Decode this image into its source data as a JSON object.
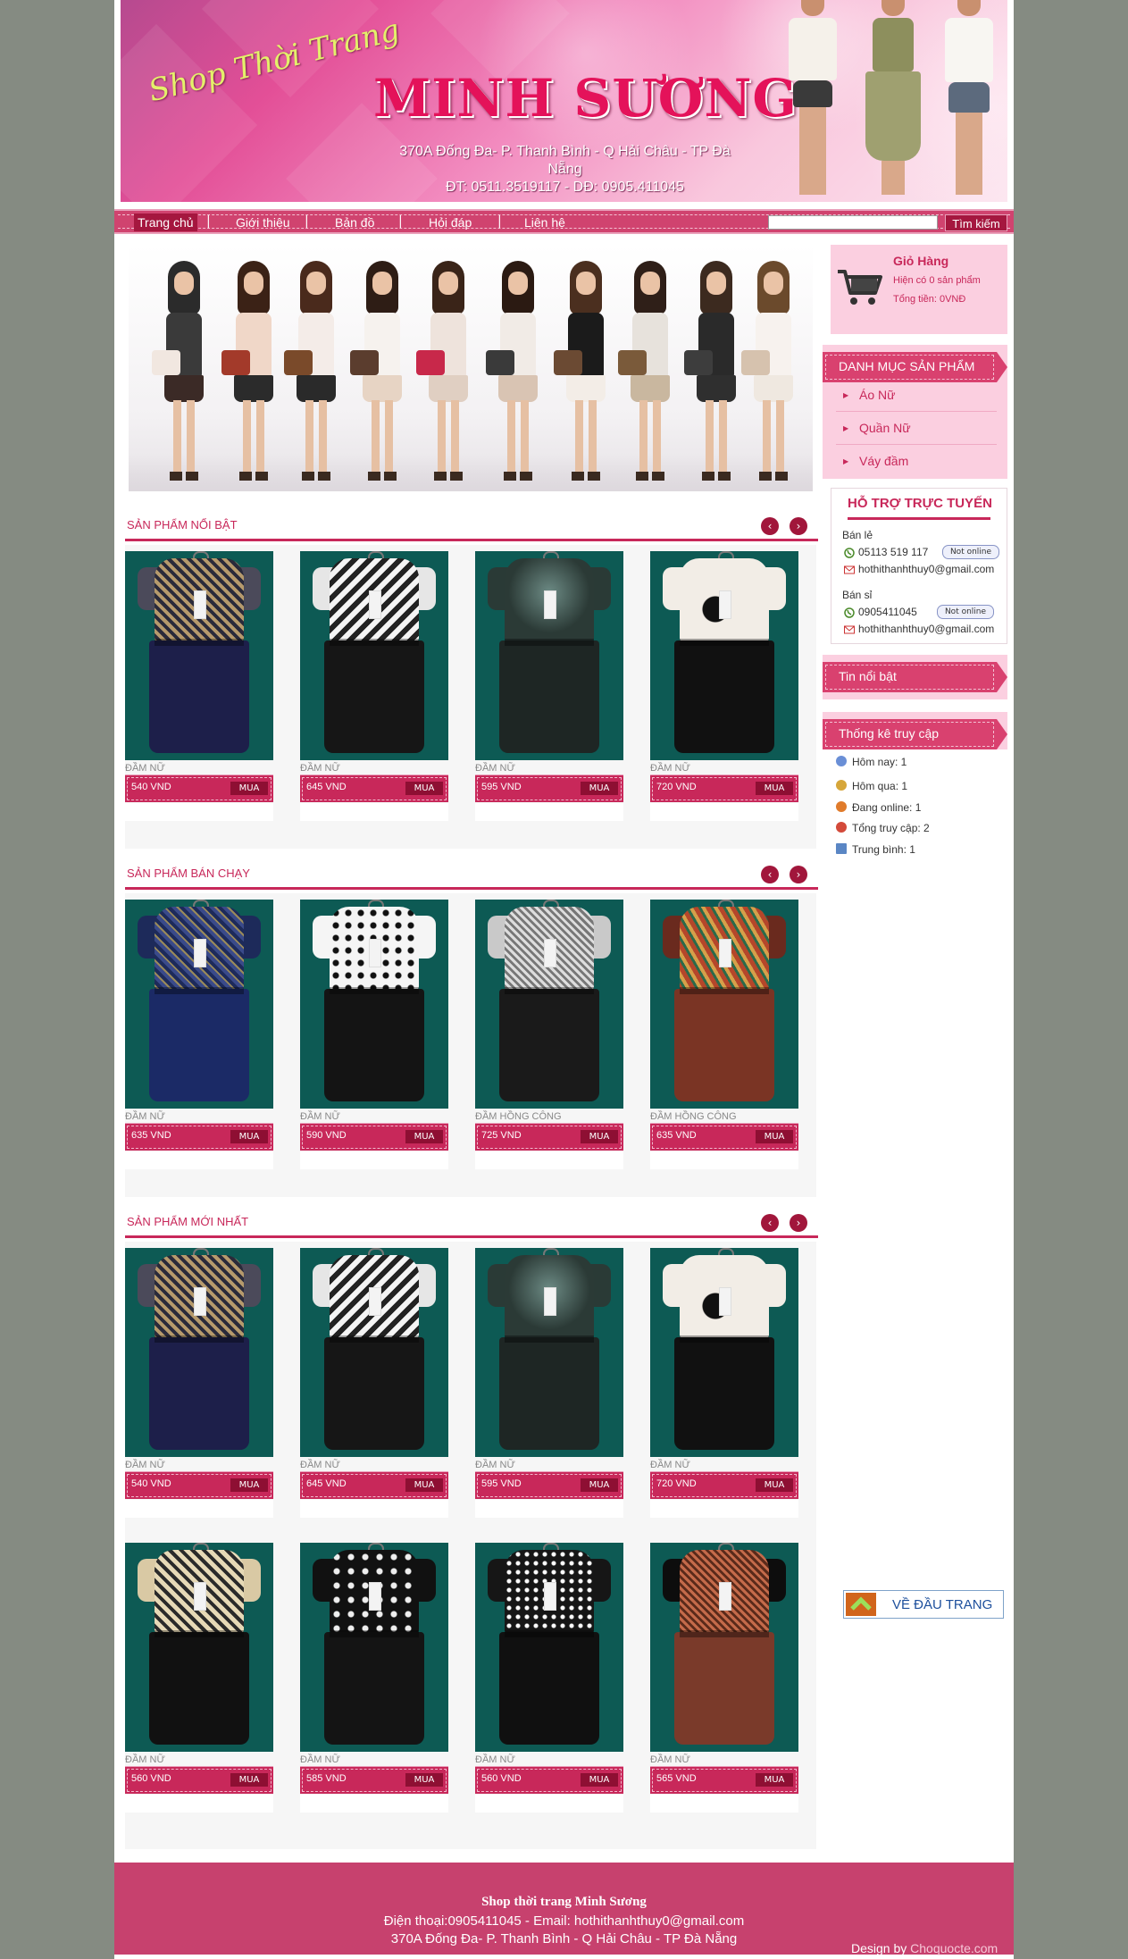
{
  "header": {
    "script_title": "Shop Thời Trang",
    "shop_name": "MINH SƯƠNG",
    "address": "370A Đống Đa- P. Thanh Bình - Q Hải Châu - TP Đà Nẵng",
    "phones": "ĐT: 0511.3519117 - DĐ: 0905.411045"
  },
  "nav": {
    "items": [
      {
        "label": "Trang chủ"
      },
      {
        "label": "Giới thiệu"
      },
      {
        "label": "Bản đồ"
      },
      {
        "label": "Hỏi đáp"
      },
      {
        "label": "Liên hệ"
      }
    ],
    "separator": "|",
    "search_placeholder": "",
    "search_button": "Tìm kiếm"
  },
  "arrows": {
    "prev": "‹",
    "next": "›"
  },
  "sections": [
    {
      "title": "SẢN PHẨM NỔI BẬT",
      "products": [
        {
          "category": "ĐẦM NỮ",
          "price": "540 VND",
          "buy": "MUA"
        },
        {
          "category": "ĐẦM NỮ",
          "price": "645 VND",
          "buy": "MUA"
        },
        {
          "category": "ĐẦM NỮ",
          "price": "595 VND",
          "buy": "MUA"
        },
        {
          "category": "ĐẦM NỮ",
          "price": "720 VND",
          "buy": "MUA"
        }
      ]
    },
    {
      "title": "SẢN PHẨM BÁN CHẠY",
      "products": [
        {
          "category": "ĐẦM NỮ",
          "price": "635 VND",
          "buy": "MUA"
        },
        {
          "category": "ĐẦM NỮ",
          "price": "590 VND",
          "buy": "MUA"
        },
        {
          "category": "ĐẦM HỒNG CÔNG",
          "price": "725 VND",
          "buy": "MUA"
        },
        {
          "category": "ĐẦM HỒNG CÔNG",
          "price": "635 VND",
          "buy": "MUA"
        }
      ]
    },
    {
      "title": "SẢN PHẨM MỚI NHẤT",
      "products": [
        {
          "category": "ĐẦM NỮ",
          "price": "540 VND",
          "buy": "MUA"
        },
        {
          "category": "ĐẦM NỮ",
          "price": "645 VND",
          "buy": "MUA"
        },
        {
          "category": "ĐẦM NỮ",
          "price": "595 VND",
          "buy": "MUA"
        },
        {
          "category": "ĐẦM NỮ",
          "price": "720 VND",
          "buy": "MUA"
        },
        {
          "category": "ĐẦM NỮ",
          "price": "560 VND",
          "buy": "MUA"
        },
        {
          "category": "ĐẦM NỮ",
          "price": "585 VND",
          "buy": "MUA"
        },
        {
          "category": "ĐẦM NỮ",
          "price": "560 VND",
          "buy": "MUA"
        },
        {
          "category": "ĐẦM NỮ",
          "price": "565 VND",
          "buy": "MUA"
        }
      ]
    }
  ],
  "cart": {
    "title": "Giỏ Hàng",
    "count_text": "Hiện có 0 sản phẩm",
    "total_text": "Tổng tiền: 0VNĐ"
  },
  "categories": {
    "title": "DANH MỤC SẢN PHẨM",
    "items": [
      {
        "label": "Áo Nữ"
      },
      {
        "label": "Quần Nữ"
      },
      {
        "label": "Váy đầm"
      }
    ]
  },
  "support": {
    "title": "HỖ TRỢ TRỰC TUYẾN",
    "retail_label": "Bán lẻ",
    "retail_phone": "05113 519 117",
    "retail_email": "hothithanhthuy0@gmail.com",
    "wholesale_label": "Bán sỉ",
    "wholesale_phone": "0905411045",
    "wholesale_email": "hothithanhthuy0@gmail.com",
    "status": "Not online"
  },
  "news": {
    "title": "Tin nổi bật"
  },
  "stats": {
    "title": "Thống kê truy cập",
    "items": [
      {
        "label": "Hôm nay: 1"
      },
      {
        "label": "Hôm qua: 1"
      },
      {
        "label": "Đang online: 1"
      },
      {
        "label": "Tổng truy cập: 2"
      },
      {
        "label": "Trung bình: 1"
      }
    ]
  },
  "back_to_top": "VỀ ĐẦU TRANG",
  "footer": {
    "shop_name": "Shop thời trang Minh Sương",
    "contact": "Điện thoại:0905411045 - Email: hothithanhthuy0@gmail.com",
    "address": "370A Đống Đa- P. Thanh Bình - Q Hải Châu - TP Đà Nẵng",
    "design_prefix": "Design by",
    "design_site": "Choquocte.com"
  },
  "colors": {
    "brand": "#c8285a",
    "nav": "#d0436f",
    "cart_bg": "#fbcfe0",
    "page_bg": "#858b82"
  }
}
